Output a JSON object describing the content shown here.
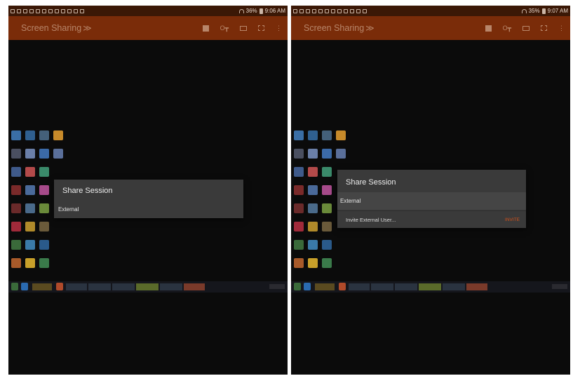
{
  "screens": [
    {
      "status": {
        "battery": "36%",
        "time": "9:06 AM"
      },
      "appbar": {
        "title": "Screen Sharing",
        "chevron": "≫"
      },
      "dialog": {
        "title": "Share Session",
        "group_label": "External",
        "items": []
      }
    },
    {
      "status": {
        "battery": "35%",
        "time": "9:07 AM"
      },
      "appbar": {
        "title": "Screen Sharing",
        "chevron": "≫"
      },
      "dialog": {
        "title": "Share Session",
        "group_label": "External",
        "items": [
          {
            "label": "Invite External User...",
            "action": "INVITE"
          }
        ]
      }
    }
  ],
  "colors": {
    "appbar": "#7a2c09",
    "statusbar": "#3b1806",
    "dialog": "#3a3a3a",
    "accent": "#d2511a"
  },
  "icons": [
    "wifi-icon",
    "battery-icon",
    "stop-icon",
    "key-icon",
    "keyboard-icon",
    "fullscreen-icon",
    "overflow-menu-icon"
  ]
}
